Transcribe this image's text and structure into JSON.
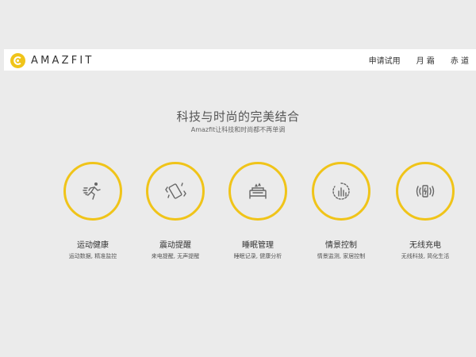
{
  "brand": {
    "name": "AMAZFIT",
    "accent": "#f0c419"
  },
  "nav": {
    "items": [
      {
        "label": "申请试用"
      },
      {
        "label": "月 霜"
      },
      {
        "label": "赤 道"
      }
    ]
  },
  "hero": {
    "title": "科技与时尚的完美结合",
    "subtitle": "Amazfit让科技和时尚都不再单调"
  },
  "features": [
    {
      "icon": "running-person-icon",
      "title": "运动健康",
      "desc": "运动数据, 精准监控"
    },
    {
      "icon": "vibration-phone-icon",
      "title": "震动提醒",
      "desc": "来电提醒, 无声提醒"
    },
    {
      "icon": "bed-sleep-icon",
      "title": "睡眠管理",
      "desc": "睡眠记录, 健康分析"
    },
    {
      "icon": "scene-control-icon",
      "title": "情景控制",
      "desc": "情景监测, 家居控制"
    },
    {
      "icon": "wireless-charging-icon",
      "title": "无线充电",
      "desc": "无线科技, 简化生活"
    }
  ]
}
